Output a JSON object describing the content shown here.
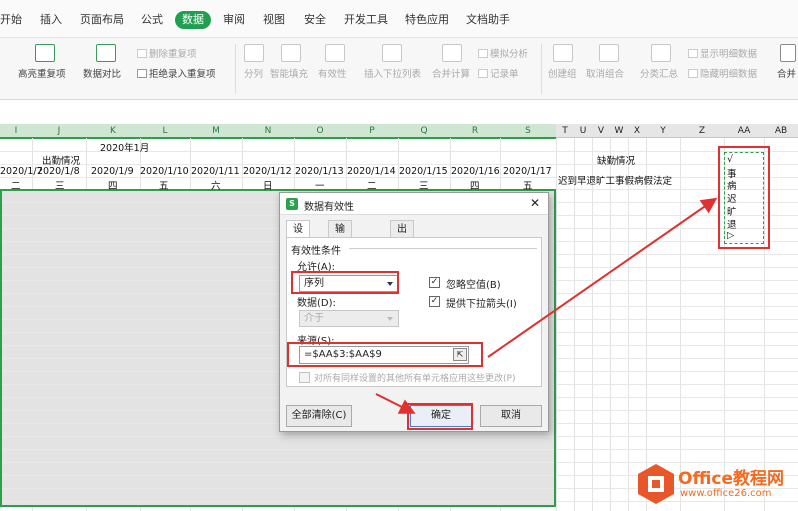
{
  "menubar": {
    "items": [
      "开始",
      "插入",
      "页面布局",
      "公式",
      "数据",
      "审阅",
      "视图",
      "安全",
      "开发工具",
      "特色应用",
      "文档助手"
    ],
    "active_index": 4
  },
  "ribbon": {
    "highlight_dup": "高亮重复项",
    "data_compare": "数据对比",
    "delete_dup": "删除重复项",
    "reject_dup": "拒绝录入重复项",
    "split": "分列",
    "smart_fill": "智能填充",
    "validity": "有效性",
    "insert_dropdown": "插入下拉列表",
    "merge_calc": "合并计算",
    "simulate": "模拟分析",
    "record_list": "记录单",
    "create_group": "创建组",
    "ungroup": "取消组合",
    "subtotal": "分类汇总",
    "show_detail": "显示明细数据",
    "hide_detail": "隐藏明细数据",
    "merge_tail": "合并"
  },
  "sheet": {
    "col_headers": [
      "I",
      "J",
      "K",
      "L",
      "M",
      "N",
      "O",
      "P",
      "Q",
      "R",
      "S",
      "T",
      "U",
      "V",
      "W",
      "X",
      "Y",
      "Z",
      "AA",
      "AB"
    ],
    "month_title": "2020年1月",
    "attendance_title": "出勤情况",
    "absence_title": "缺勤情况",
    "dates": [
      "2020/1/7",
      "2020/1/8",
      "2020/1/9",
      "2020/1/10",
      "2020/1/11",
      "2020/1/12",
      "2020/1/13",
      "2020/1/14",
      "2020/1/15",
      "2020/1/16",
      "2020/1/17"
    ],
    "weekdays": [
      "二",
      "三",
      "四",
      "五",
      "六",
      "日",
      "一",
      "二",
      "三",
      "四",
      "五"
    ],
    "absence_types": "迟到早退旷工事假病假法定",
    "aa_list": [
      "√",
      "事",
      "病",
      "迟",
      "旷",
      "退",
      "▷"
    ]
  },
  "dialog": {
    "title": "数据有效性",
    "tabs": [
      "设置",
      "输入信息",
      "出错警告"
    ],
    "section_label": "有效性条件",
    "allow_label": "允许(A):",
    "allow_value": "序列",
    "ignore_blank_label": "忽略空值(B)",
    "dropdown_label": "提供下拉箭头(I)",
    "data_label": "数据(D):",
    "data_value": "介于",
    "source_label": "来源(S):",
    "source_value": "=$AA$3:$AA$9",
    "apply_all_label": "对所有同样设置的其他所有单元格应用这些更改(P)",
    "clear_all": "全部清除(C)",
    "ok": "确定",
    "cancel": "取消"
  },
  "watermark": {
    "brand": "Office教程网",
    "url": "www.office26.com"
  },
  "colors": {
    "accent_green": "#1f9f4f",
    "highlight_red": "#e03030",
    "selection_border": "#2e9e4a"
  }
}
